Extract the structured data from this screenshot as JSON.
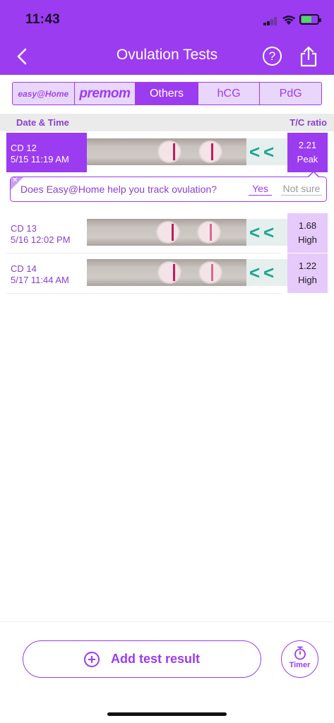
{
  "status_bar": {
    "time": "11:43"
  },
  "header": {
    "title": "Ovulation Tests"
  },
  "colors": {
    "accent": "#9b3cf0",
    "accent_light": "#e6cafb",
    "strip_line": "#c41a5e",
    "strip_arrow": "#17a890"
  },
  "brand_tabs": [
    {
      "label": "easy@Home",
      "selected": false
    },
    {
      "label": "premom",
      "selected": false
    },
    {
      "label": "Others",
      "selected": true
    },
    {
      "label": "hCG",
      "selected": false
    },
    {
      "label": "PdG",
      "selected": false
    }
  ],
  "table": {
    "col_date": "Date & Time",
    "col_ratio": "T/C ratio",
    "rows": [
      {
        "cycle_day": "CD 12",
        "datetime": "5/15 11:19 AM",
        "ratio": "2.21",
        "level": "Peak",
        "selected": true
      },
      {
        "cycle_day": "CD 13",
        "datetime": "5/16 12:02 PM",
        "ratio": "1.68",
        "level": "High",
        "selected": false
      },
      {
        "cycle_day": "CD 14",
        "datetime": "5/17 11:44 AM",
        "ratio": "1.22",
        "level": "High",
        "selected": false
      }
    ]
  },
  "survey": {
    "question": "Does Easy@Home help you track ovulation?",
    "yes_label": "Yes",
    "no_label": "Not sure"
  },
  "actions": {
    "add_label": "Add test result",
    "timer_label": "Timer"
  }
}
